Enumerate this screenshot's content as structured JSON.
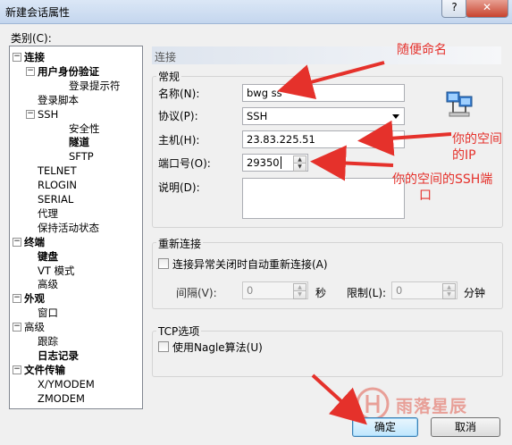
{
  "window": {
    "title": "新建会话属性",
    "help_label": "?",
    "close_label": "✕"
  },
  "category_label": "类别(C):",
  "tree": [
    {
      "label": "连接",
      "level": 0,
      "expander": "−"
    },
    {
      "label": "用户身份验证",
      "level": 1,
      "expander": "−",
      "bold": true
    },
    {
      "label": "登录提示符",
      "level": 2
    },
    {
      "label": "登录脚本",
      "level": 1
    },
    {
      "label": "SSH",
      "level": 1,
      "expander": "−"
    },
    {
      "label": "安全性",
      "level": 2
    },
    {
      "label": "隧道",
      "level": 2,
      "bold": true
    },
    {
      "label": "SFTP",
      "level": 2
    },
    {
      "label": "TELNET",
      "level": 1
    },
    {
      "label": "RLOGIN",
      "level": 1
    },
    {
      "label": "SERIAL",
      "level": 1
    },
    {
      "label": "代理",
      "level": 1
    },
    {
      "label": "保持活动状态",
      "level": 1
    },
    {
      "label": "终端",
      "level": 0,
      "expander": "−"
    },
    {
      "label": "键盘",
      "level": 1,
      "bold": true
    },
    {
      "label": "VT 模式",
      "level": 1
    },
    {
      "label": "高级",
      "level": 1
    },
    {
      "label": "外观",
      "level": 0,
      "expander": "−"
    },
    {
      "label": "窗口",
      "level": 1
    },
    {
      "label": "高级",
      "level": 0,
      "expander": "−",
      "plain": true
    },
    {
      "label": "跟踪",
      "level": 1
    },
    {
      "label": "日志记录",
      "level": 1,
      "bold": true
    },
    {
      "label": "文件传输",
      "level": 0,
      "expander": "−"
    },
    {
      "label": "X/YMODEM",
      "level": 1
    },
    {
      "label": "ZMODEM",
      "level": 1
    }
  ],
  "section_title": "连接",
  "general": {
    "title": "常规",
    "name_label": "名称(N):",
    "name_value": "bwg ss",
    "protocol_label": "协议(P):",
    "protocol_value": "SSH",
    "host_label": "主机(H):",
    "host_value": "23.83.225.51",
    "port_label": "端口号(O):",
    "port_value": "29350",
    "desc_label": "说明(D):",
    "desc_value": ""
  },
  "reconnect": {
    "title": "重新连接",
    "checkbox_label": "连接异常关闭时自动重新连接(A)",
    "interval_label": "间隔(V):",
    "interval_value": "0",
    "interval_unit": "秒",
    "limit_label": "限制(L):",
    "limit_value": "0",
    "limit_unit": "分钟"
  },
  "tcp": {
    "title": "TCP选项",
    "nagle_label": "使用Nagle算法(U)"
  },
  "buttons": {
    "ok": "确定",
    "cancel": "取消"
  },
  "annotations": {
    "name": "随便命名",
    "ip_line1": "你的空间",
    "ip_line2": "的IP",
    "port_line1": "你的空间的SSH端",
    "port_line2": "口"
  },
  "watermark": {
    "text": "雨落星辰"
  },
  "colors": {
    "annotation": "#e5312b",
    "watermark": "#e89f97",
    "panel_bg": "#f0f0f0"
  }
}
